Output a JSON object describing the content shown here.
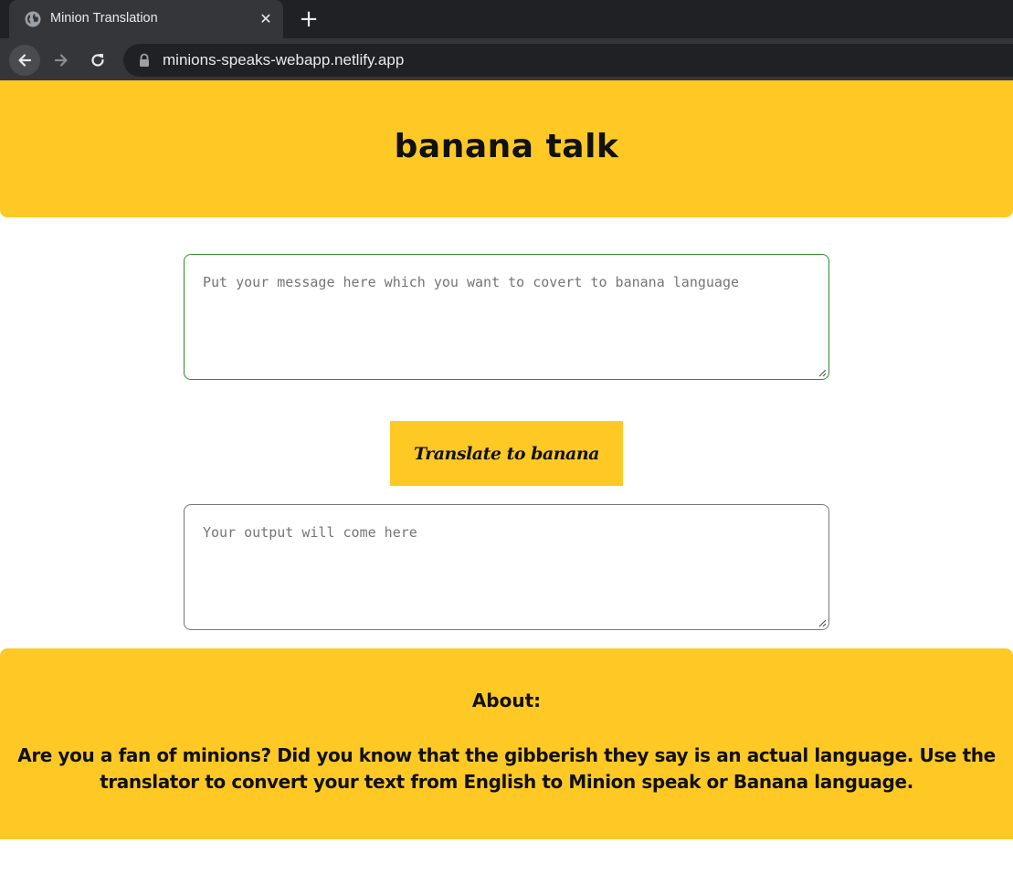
{
  "browser": {
    "tab_title": "Minion Translation",
    "url": "minions-speaks-webapp.netlify.app",
    "icons": {
      "tab": "globe-icon",
      "close": "close-icon",
      "new_tab": "plus-icon",
      "back": "back-arrow-icon",
      "forward": "forward-arrow-icon",
      "reload": "reload-icon",
      "lock": "lock-icon"
    }
  },
  "header": {
    "title": "banana talk"
  },
  "input": {
    "value": "",
    "placeholder": "Put your message here which you want to covert to banana language"
  },
  "translate_button": {
    "label": "Translate to banana"
  },
  "output": {
    "value": "",
    "placeholder": "Your output will come here"
  },
  "about": {
    "heading": "About:",
    "text": "Are you a fan of minions? Did you know that the gibberish they say is an actual language. Use the translator to convert your text from English to Minion speak or Banana language."
  },
  "colors": {
    "accent_yellow": "#fec925",
    "input_border": "#2e8b2e",
    "output_border": "#767676",
    "chrome_dark": "#202124",
    "chrome_tab": "#35363a"
  }
}
